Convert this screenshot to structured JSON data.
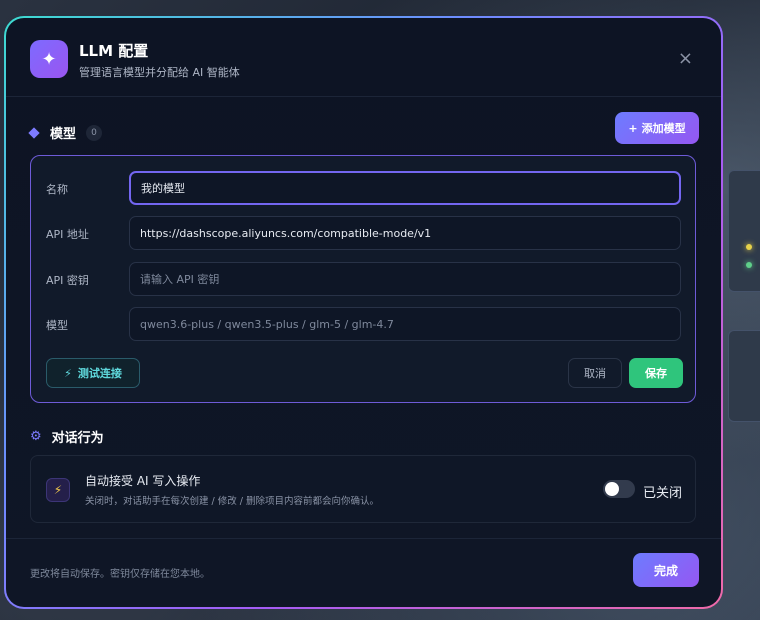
{
  "header": {
    "logo_glyph": "✦",
    "title": "LLM 配置",
    "subtitle": "管理语言模型并分配给 AI 智能体",
    "close_glyph": "×"
  },
  "models": {
    "section_title": "模型",
    "count": "0",
    "add_button": "添加模型",
    "add_glyph": "+"
  },
  "form": {
    "name_label": "名称",
    "name_value": "我的模型",
    "url_label": "API 地址",
    "url_value": "https://dashscope.aliyuncs.com/compatible-mode/v1",
    "key_label": "API 密钥",
    "key_placeholder": "请输入 API 密钥",
    "model_label": "模型",
    "model_placeholder": "qwen3.6-plus / qwen3.5-plus / glm-5 / glm-4.7",
    "test_button": "测试连接",
    "test_glyph": "⚡",
    "cancel_button": "取消",
    "save_button": "保存"
  },
  "behavior": {
    "section_title": "对话行为",
    "gear_glyph": "⚙",
    "item_glyph": "⚡",
    "item_title": "自动接受 AI 写入操作",
    "item_desc": "关闭时，对话助手在每次创建 / 修改 / 删除项目内容前都会向你确认。",
    "toggle_state": "已关闭",
    "toggle_on": false
  },
  "footer": {
    "note": "更改将自动保存。密钥仅存储在您本地。",
    "done_button": "完成"
  },
  "colors": {
    "accent": "#7366f0",
    "save_green": "#2fc57c",
    "test_cyan": "#5fd9dd"
  }
}
